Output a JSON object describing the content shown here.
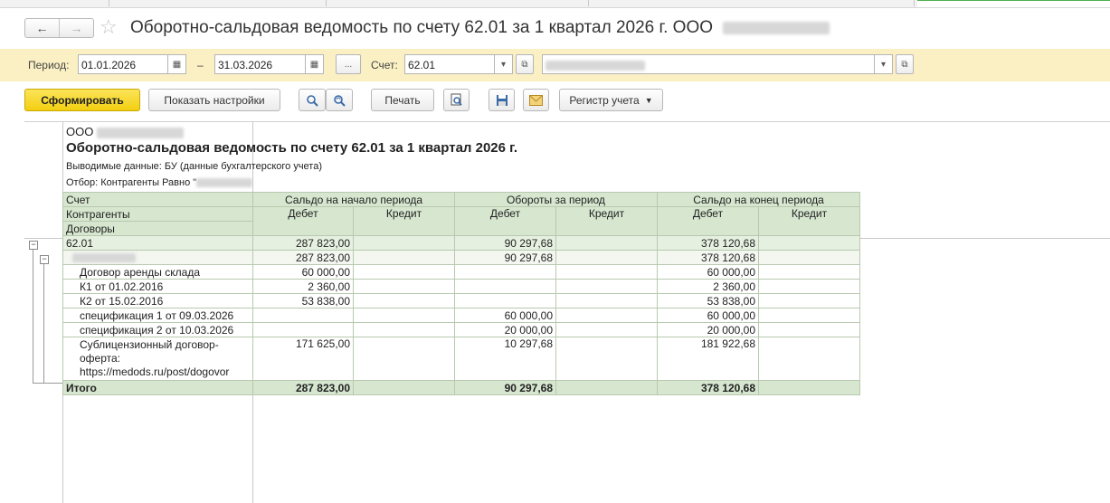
{
  "window": {
    "title": "Оборотно-сальдовая ведомость по счету 62.01 за 1 квартал 2026 г. ООО",
    "back_icon": "←",
    "forward_icon": "→",
    "star_icon": "☆"
  },
  "filter": {
    "period_label": "Период:",
    "date_from": "01.01.2026",
    "dash": "–",
    "date_to": "31.03.2026",
    "ellipsis": "...",
    "account_label": "Счет:",
    "account_value": "62.01"
  },
  "toolbar": {
    "generate": "Сформировать",
    "show_settings": "Показать настройки",
    "print": "Печать",
    "register": "Регистр учета"
  },
  "report": {
    "org": "ООО",
    "title": "Оборотно-сальдовая ведомость по счету 62.01 за 1 квартал 2026 г.",
    "output_data": "Выводимые данные: БУ (данные бухгалтерского учета)",
    "selection": "Отбор: Контрагенты Равно \"",
    "headers": {
      "account": "Счет",
      "counterparties": "Контрагенты",
      "contracts": "Договоры",
      "opening_balance": "Сальдо на начало периода",
      "turnover": "Обороты за период",
      "closing_balance": "Сальдо на конец периода",
      "debit": "Дебет",
      "credit": "Кредит"
    },
    "rows": [
      {
        "name": "62.01",
        "ob_d": "287 823,00",
        "ob_c": "",
        "t_d": "90 297,68",
        "t_c": "",
        "cb_d": "378 120,68",
        "cb_c": ""
      },
      {
        "name": "",
        "ob_d": "287 823,00",
        "ob_c": "",
        "t_d": "90 297,68",
        "t_c": "",
        "cb_d": "378 120,68",
        "cb_c": ""
      },
      {
        "name": "Договор аренды склада",
        "ob_d": "60 000,00",
        "ob_c": "",
        "t_d": "",
        "t_c": "",
        "cb_d": "60 000,00",
        "cb_c": ""
      },
      {
        "name": "К1 от 01.02.2016",
        "ob_d": "2 360,00",
        "ob_c": "",
        "t_d": "",
        "t_c": "",
        "cb_d": "2 360,00",
        "cb_c": ""
      },
      {
        "name": "К2 от 15.02.2016",
        "ob_d": "53 838,00",
        "ob_c": "",
        "t_d": "",
        "t_c": "",
        "cb_d": "53 838,00",
        "cb_c": ""
      },
      {
        "name": "спецификация 1 от 09.03.2026",
        "ob_d": "",
        "ob_c": "",
        "t_d": "60 000,00",
        "t_c": "",
        "cb_d": "60 000,00",
        "cb_c": ""
      },
      {
        "name": "спецификация 2 от 10.03.2026",
        "ob_d": "",
        "ob_c": "",
        "t_d": "20 000,00",
        "t_c": "",
        "cb_d": "20 000,00",
        "cb_c": ""
      },
      {
        "name": "Сублицензионный договор-оферта: https://medods.ru/post/dogovor",
        "ob_d": "171 625,00",
        "ob_c": "",
        "t_d": "10 297,68",
        "t_c": "",
        "cb_d": "181 922,68",
        "cb_c": ""
      }
    ],
    "total": {
      "name": "Итого",
      "ob_d": "287 823,00",
      "ob_c": "",
      "t_d": "90 297,68",
      "t_c": "",
      "cb_d": "378 120,68",
      "cb_c": ""
    }
  }
}
